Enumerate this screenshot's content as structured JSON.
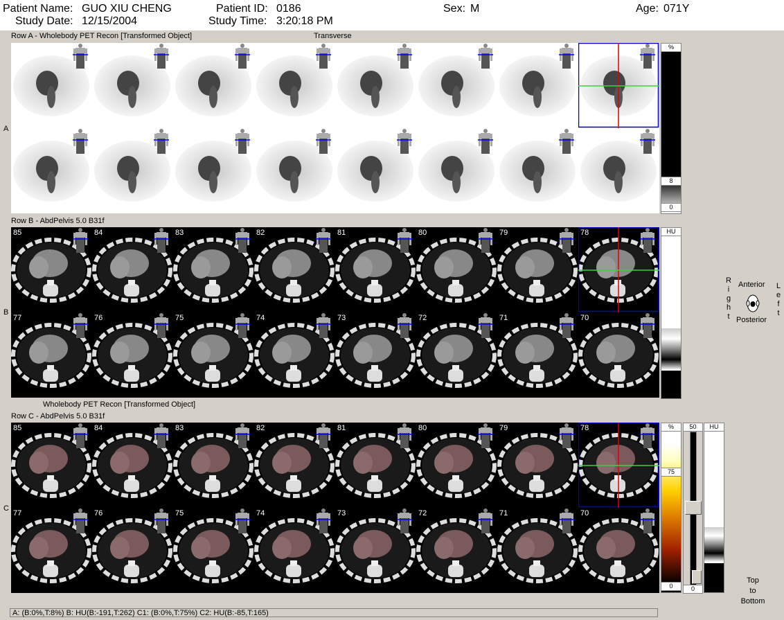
{
  "header": {
    "patient_name_label": "Patient Name:",
    "patient_name": "GUO XIU CHENG",
    "patient_id_label": "Patient ID:",
    "patient_id": "0186",
    "sex_label": "Sex:",
    "sex": "M",
    "age_label": "Age:",
    "age": "071Y",
    "study_date_label": "Study Date:",
    "study_date": "12/15/2004",
    "study_time_label": "Study Time:",
    "study_time": "3:20:18 PM"
  },
  "row_a": {
    "title": "Row A - Wholebody PET  Recon [Transformed Object]",
    "view": "Transverse",
    "letter": "A",
    "scale_top": "%",
    "scale_mid": "8",
    "scale_bottom": "0"
  },
  "row_b": {
    "title": "Row B - AbdPelvis  5.0  B31f",
    "letter": "B",
    "scale_top": "HU",
    "slices_top": [
      "85",
      "84",
      "83",
      "82",
      "81",
      "80",
      "79",
      "78"
    ],
    "slices_bottom": [
      "77",
      "76",
      "75",
      "74",
      "73",
      "72",
      "71",
      "70"
    ]
  },
  "row_c": {
    "title_pet": "Wholebody PET  Recon [Transformed Object]",
    "title": "Row C - AbdPelvis  5.0  B31f",
    "letter": "C",
    "scale_pct": "%",
    "scale_75": "75",
    "scale_0a": "0",
    "scale_50": "50",
    "scale_0b": "0",
    "scale_hu": "HU",
    "slices_top": [
      "85",
      "84",
      "83",
      "82",
      "81",
      "80",
      "79",
      "78"
    ],
    "slices_bottom": [
      "77",
      "76",
      "75",
      "74",
      "73",
      "72",
      "71",
      "70"
    ]
  },
  "orientation": {
    "anterior": "Anterior",
    "posterior": "Posterior",
    "right": "Right",
    "left": "Left",
    "top_to_bottom": [
      "Top",
      "to",
      "Bottom"
    ]
  },
  "status_bar": "A: (B:0%,T:8%)    B: HU(B:-191,T:262)    C1: (B:0%,T:75%)    C2: HU(B:-85,T:165)",
  "colors": {
    "selection": "#0000c0",
    "crosshair_vertical": "#e00000",
    "crosshair_horizontal": "#40d040",
    "mini_marker": "#0000ff"
  }
}
